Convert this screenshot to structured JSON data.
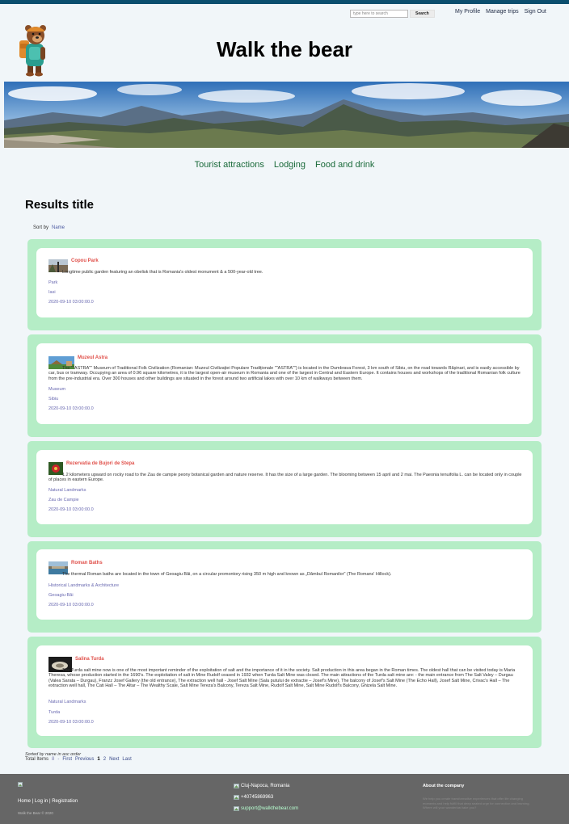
{
  "header": {
    "search_placeholder": "type here to search",
    "search_button": "Search",
    "user_nav": [
      "My Profile",
      "Manage trips",
      "Sign Out"
    ],
    "site_title": "Walk the bear"
  },
  "main_nav": [
    "Tourist attractions",
    "Lodging",
    "Food and drink"
  ],
  "results": {
    "title": "Results title",
    "sort_by_label": "Sort by",
    "sort_by_field": "Name",
    "items": [
      {
        "title": "Copou Park",
        "description": "Longtime public garden featuring an obelisk that is Romania's oldest monument & a 500-year-old tree.",
        "category": "Park",
        "city": "Iasi",
        "date": "2020-09-10 03:00:00.0"
      },
      {
        "title": "Muzeul Astra",
        "description": "The \"\"ASTRA\"\" Museum of Traditional Folk Civilization (Romanian: Muzeul Civilizației Populare Tradiționale \"\"ASTRA\"\") is located in the Dumbrava Forest, 3 km south of Sibiu, on the road towards Rășinari, and is easily accessible by car, bus or tramway. Occupying an area of 0.96 square kilometres, it is the largest open-air museum in Romania and one of the largest in Central and Eastern Europe. It contains houses and workshops of the traditional Romanian folk culture from the pre-industrial era. Over 300 houses and other buildings are situated in the forest around two artificial lakes with over 10 km of walkways between them.",
        "category": "Museum",
        "city": "Sibiu",
        "date": "2020-09-10 03:00:00.0"
      },
      {
        "title": "Rezervatia de Bujori de Stepa",
        "description": "1.2 kilometers upward on rocky road to the Zau de campie peony botanical garden and nature reserve. It has the size of a large garden. The blooming between 15 april and 2 mai. The Paeonia tenuifolia L. can be located only in couple of places in eastern Europe.",
        "category": "Natural Landmarks",
        "city": "Zau de Campie",
        "date": "2020-09-10 03:00:00.0"
      },
      {
        "title": "Roman Baths",
        "description": "The thermal Roman baths are located in the town of Geoagiu Băi, on a circular promontory rising 350 m high and known as „Dâmbul Romanilor\" (The Romans' Hillock).",
        "category": "Historical Landmarks & Architecture",
        "city": "Geoagiu-Băi",
        "date": "2020-09-10 03:00:00.0"
      },
      {
        "title": "Salina Turda",
        "description": "The Turda salt mine now is one of the most important reminder of the exploitation of salt and the importance of it in the society. Salt production in this area began in the Roman times. The oldest hall that can be visited today is Maria Theresa, whose production started in the 1690's. The exploitation of salt in Mine Rudolf ceased in 1932 when Turda Salt Mine was closed. The main attractions of the Turda salt mine are: - the main entrance from The Salt Valey – Durgau (Valea Sarata – Durgau), Franzz Josef Gallery (the old entrance), The extraction well hall - Josef Salt Mine (Sala putului de extractie – Josef's Mine), The balcony of Josef's Salt Mine (The Echo Hall), Josef Salt Mine, Crivac's Hall – The extraction well hall, The Cati Hall – The Altar – The Wealthy Scale, Salt Mine Tereza's Balcony, Tereza Salt Mine, Rudolf Salt Mine, Salt Mine Rudolf's Balcony, Ghizela Salt Mine.",
        "category": "Natural Landmarks",
        "city": "Turda",
        "date": "2020-09-10 03:00:00.0"
      }
    ]
  },
  "pagination": {
    "sorted_note": "Sorted by name in asc order",
    "total_label": "Total Items",
    "total_value": "8",
    "separator": "-",
    "first": "First",
    "previous": "Previous",
    "pages": [
      "1",
      "2"
    ],
    "next": "Next",
    "last": "Last"
  },
  "footer": {
    "links": [
      "Home",
      "Log in",
      "Registration"
    ],
    "link_separator": "|",
    "copyright": "Walk the Bear © 2020",
    "location": "Cluj-Napoca, Romania",
    "phone": "+40745869963",
    "email": "support@walkthebear.com",
    "about_title": "About the company",
    "about_text": "We help you create transformative experiences that offer life changing moments and help fulfill that deep seated urge for connection and learning. Where will your wanderlust take you?"
  },
  "colors": {
    "accent_title": "#e0504a",
    "card_outer": "#b5edc6",
    "nav_green": "#1a6a3a",
    "footer_bg": "#666666"
  }
}
